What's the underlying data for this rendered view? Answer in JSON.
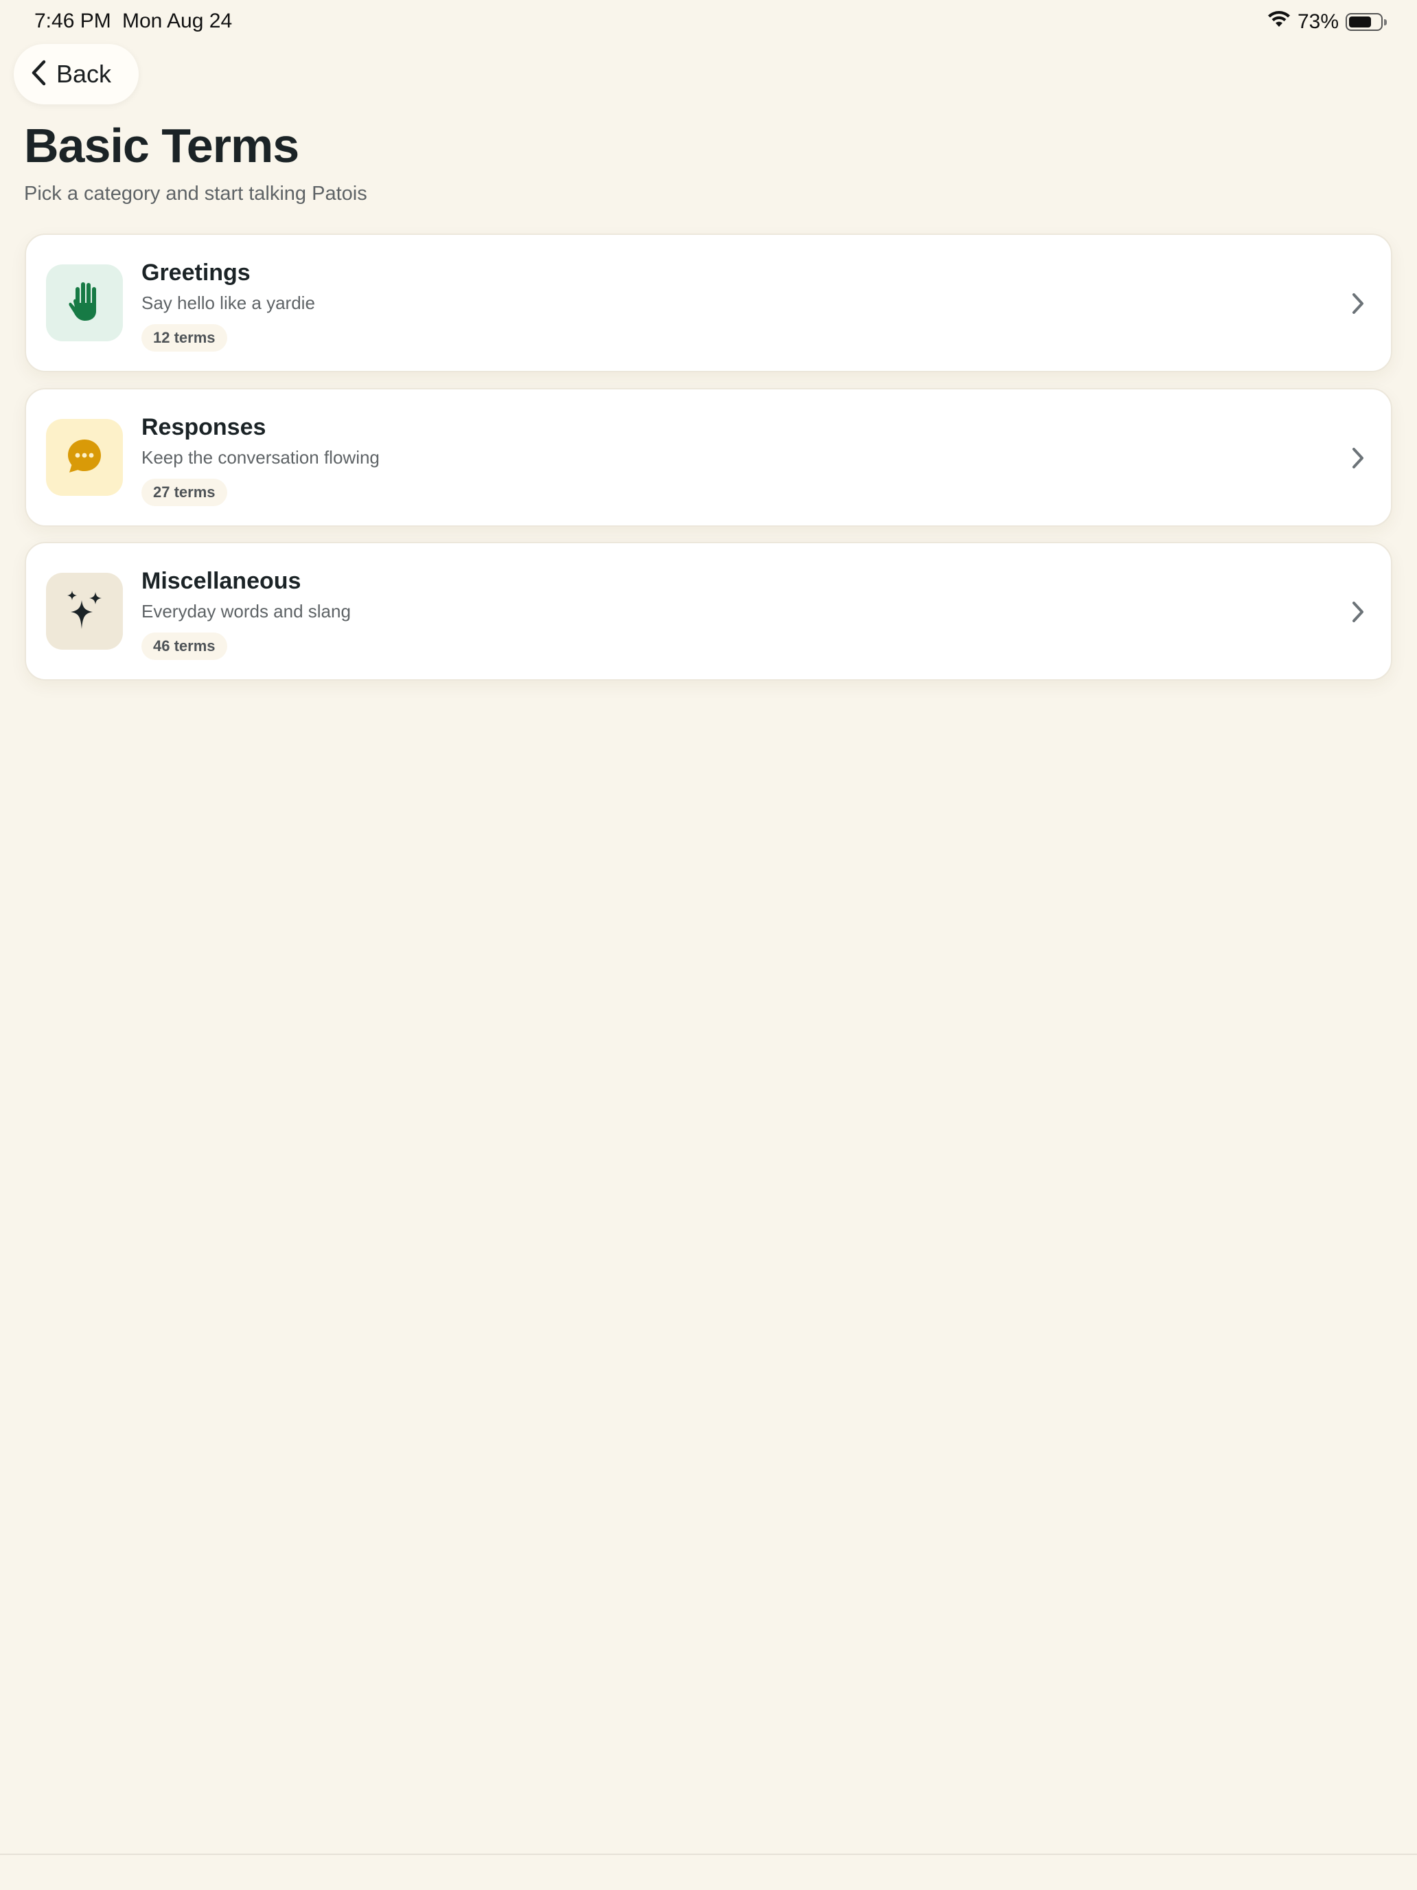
{
  "status_bar": {
    "time": "7:46 PM",
    "date": "Mon Aug 24",
    "battery": "73%",
    "battery_level": 0.73,
    "wifi_icon": "wifi-icon"
  },
  "nav": {
    "back_label": "Back",
    "back_icon": "chevron-left-icon"
  },
  "header": {
    "title": "Basic Terms",
    "subtitle": "Pick a category and start talking Patois"
  },
  "categories": [
    {
      "title": "Greetings",
      "description": "Say hello like a yardie",
      "count": "12 terms",
      "icon": "hand-wave-icon",
      "icon_color": "#177A45",
      "icon_bg": "#E3F2EA"
    },
    {
      "title": "Responses",
      "description": "Keep the conversation flowing",
      "count": "27 terms",
      "icon": "chat-bubble-icon",
      "icon_color": "#D99A08",
      "icon_bg": "#FDF1C9"
    },
    {
      "title": "Miscellaneous",
      "description": "Everyday words and slang",
      "count": "46 terms",
      "icon": "sparkles-icon",
      "icon_color": "#1B2326",
      "icon_bg": "#EFE8D8"
    }
  ]
}
